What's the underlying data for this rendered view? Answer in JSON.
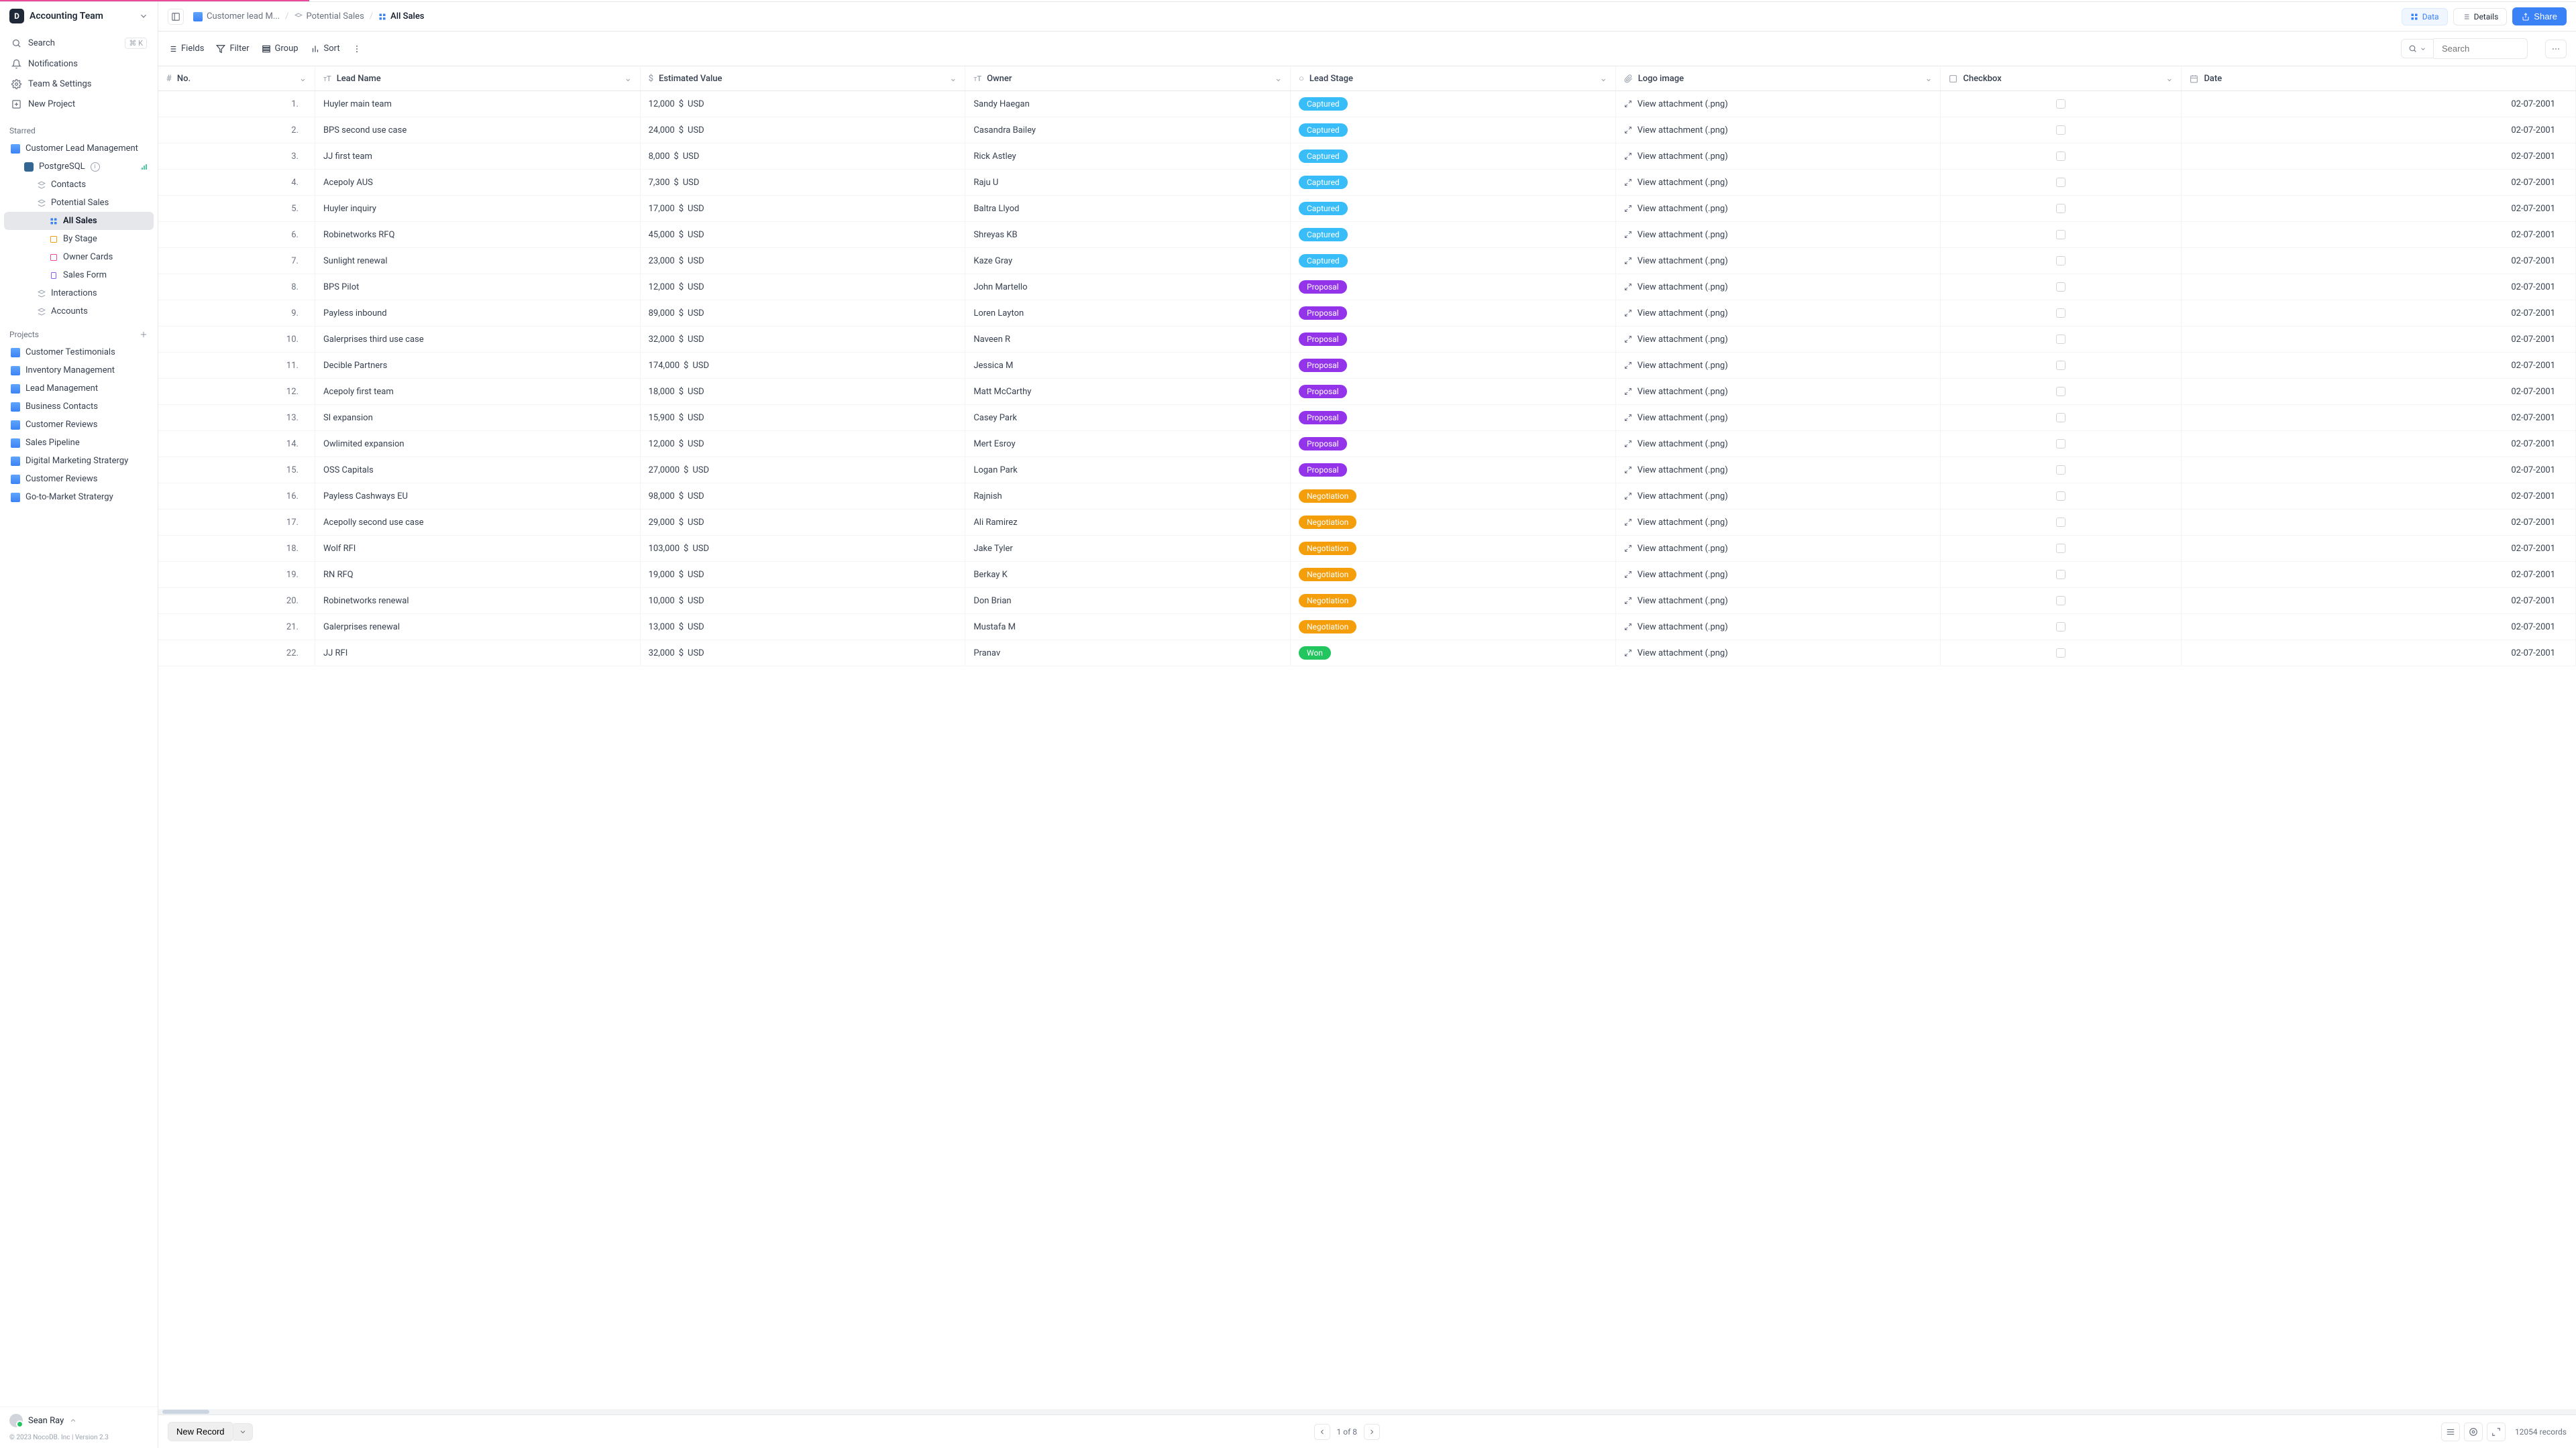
{
  "team": {
    "name": "Accounting Team"
  },
  "nav": {
    "search": "Search",
    "search_kbd": "⌘ K",
    "notifications": "Notifications",
    "team_settings": "Team & Settings",
    "new_project": "New Project"
  },
  "sections": {
    "starred": "Starred",
    "projects": "Projects"
  },
  "starred": {
    "clm": "Customer Lead Management",
    "pg": "PostgreSQL",
    "contacts": "Contacts",
    "potential_sales": "Potential Sales",
    "all_sales": "All Sales",
    "by_stage": "By Stage",
    "owner_cards": "Owner Cards",
    "sales_form": "Sales Form",
    "interactions": "Interactions",
    "accounts": "Accounts"
  },
  "projects": [
    "Customer Testimonials",
    "Inventory Management",
    "Lead Management",
    "Business Contacts",
    "Customer Reviews",
    "Sales Pipeline",
    "Digital Marketing Stratergy",
    "Customer Reviews",
    "Go-to-Market Stratergy"
  ],
  "user": {
    "name": "Sean Ray"
  },
  "copyright": "© 2023 NocoDB. Inc | Version 2.3",
  "breadcrumbs": [
    "Customer lead M...",
    "Potential Sales",
    "All Sales"
  ],
  "topbar": {
    "data": "Data",
    "details": "Details",
    "share": "Share"
  },
  "toolbar": {
    "fields": "Fields",
    "filter": "Filter",
    "group": "Group",
    "sort": "Sort",
    "search_placeholder": "Search"
  },
  "columns": {
    "no": "No.",
    "lead_name": "Lead Name",
    "estimated_value": "Estimated Value",
    "owner": "Owner",
    "lead_stage": "Lead Stage",
    "logo_image": "Logo image",
    "checkbox": "Checkbox",
    "date": "Date"
  },
  "attachment_label": "View attachment (.png)",
  "rows": [
    {
      "n": "1.",
      "name": "Huyler main team",
      "val": "12,000",
      "owner": "Sandy Haegan",
      "stage": "Captured",
      "date": "02-07-2001"
    },
    {
      "n": "2.",
      "name": "BPS second use case",
      "val": "24,000",
      "owner": "Casandra Bailey",
      "stage": "Captured",
      "date": "02-07-2001"
    },
    {
      "n": "3.",
      "name": "JJ first team",
      "val": "8,000",
      "owner": "Rick Astley",
      "stage": "Captured",
      "date": "02-07-2001"
    },
    {
      "n": "4.",
      "name": "Acepoly AUS",
      "val": "7,300",
      "owner": "Raju U",
      "stage": "Captured",
      "date": "02-07-2001"
    },
    {
      "n": "5.",
      "name": "Huyler inquiry",
      "val": "17,000",
      "owner": "Baltra Llyod",
      "stage": "Captured",
      "date": "02-07-2001"
    },
    {
      "n": "6.",
      "name": "Robinetworks RFQ",
      "val": "45,000",
      "owner": "Shreyas KB",
      "stage": "Captured",
      "date": "02-07-2001"
    },
    {
      "n": "7.",
      "name": "Sunlight renewal",
      "val": "23,000",
      "owner": "Kaze Gray",
      "stage": "Captured",
      "date": "02-07-2001"
    },
    {
      "n": "8.",
      "name": "BPS Pilot",
      "val": "12,000",
      "owner": "John Martello",
      "stage": "Proposal",
      "date": "02-07-2001"
    },
    {
      "n": "9.",
      "name": "Payless inbound",
      "val": "89,000",
      "owner": "Loren Layton",
      "stage": "Proposal",
      "date": "02-07-2001"
    },
    {
      "n": "10.",
      "name": "Galerprises third use case",
      "val": "32,000",
      "owner": "Naveen R",
      "stage": "Proposal",
      "date": "02-07-2001"
    },
    {
      "n": "11.",
      "name": "Decible Partners",
      "val": "174,000",
      "owner": "Jessica M",
      "stage": "Proposal",
      "date": "02-07-2001"
    },
    {
      "n": "12.",
      "name": "Acepoly first team",
      "val": "18,000",
      "owner": "Matt McCarthy",
      "stage": "Proposal",
      "date": "02-07-2001"
    },
    {
      "n": "13.",
      "name": "SI expansion",
      "val": "15,900",
      "owner": "Casey Park",
      "stage": "Proposal",
      "date": "02-07-2001"
    },
    {
      "n": "14.",
      "name": "Owlimited expansion",
      "val": "12,000",
      "owner": "Mert Esroy",
      "stage": "Proposal",
      "date": "02-07-2001"
    },
    {
      "n": "15.",
      "name": "OSS Capitals",
      "val": "27,0000",
      "owner": "Logan Park",
      "stage": "Proposal",
      "date": "02-07-2001"
    },
    {
      "n": "16.",
      "name": "Payless Cashways EU",
      "val": "98,000",
      "owner": "Rajnish",
      "stage": "Negotiation",
      "date": "02-07-2001"
    },
    {
      "n": "17.",
      "name": "Acepolly second use case",
      "val": "29,000",
      "owner": "Ali Ramirez",
      "stage": "Negotiation",
      "date": "02-07-2001"
    },
    {
      "n": "18.",
      "name": "Wolf RFI",
      "val": "103,000",
      "owner": "Jake Tyler",
      "stage": "Negotiation",
      "date": "02-07-2001"
    },
    {
      "n": "19.",
      "name": "RN RFQ",
      "val": "19,000",
      "owner": "Berkay K",
      "stage": "Negotiation",
      "date": "02-07-2001"
    },
    {
      "n": "20.",
      "name": "Robinetworks renewal",
      "val": "10,000",
      "owner": "Don Brian",
      "stage": "Negotiation",
      "date": "02-07-2001"
    },
    {
      "n": "21.",
      "name": "Galerprises renewal",
      "val": "13,000",
      "owner": "Mustafa M",
      "stage": "Negotiation",
      "date": "02-07-2001"
    },
    {
      "n": "22.",
      "name": "JJ RFI",
      "val": "32,000",
      "owner": "Pranav",
      "stage": "Won",
      "date": "02-07-2001"
    }
  ],
  "footer": {
    "new_record": "New Record",
    "pager": "1 of 8",
    "record_count": "12054 records"
  }
}
